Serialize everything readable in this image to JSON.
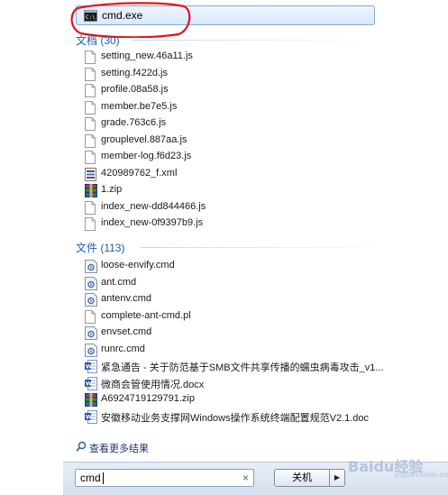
{
  "top_result": {
    "label": "cmd.exe",
    "icon": "cmd-console-icon"
  },
  "documents": {
    "header": "文档 (30)",
    "items": [
      {
        "label": "setting_new.46a11.js",
        "icon": "file"
      },
      {
        "label": "setting.f422d.js",
        "icon": "file"
      },
      {
        "label": "profile.08a58.js",
        "icon": "file"
      },
      {
        "label": "member.be7e5.js",
        "icon": "file"
      },
      {
        "label": "grade.763c6.js",
        "icon": "file"
      },
      {
        "label": "grouplevel.887aa.js",
        "icon": "file"
      },
      {
        "label": "member-log.f6d23.js",
        "icon": "file"
      },
      {
        "label": "420989762_f.xml",
        "icon": "xml"
      },
      {
        "label": "1.zip",
        "icon": "zip"
      },
      {
        "label": "index_new-dd844466.js",
        "icon": "file"
      },
      {
        "label": "index_new-0f9397b9.js",
        "icon": "file"
      }
    ]
  },
  "files": {
    "header": "文件 (113)",
    "items": [
      {
        "label": "loose-envify.cmd",
        "icon": "cmd"
      },
      {
        "label": "ant.cmd",
        "icon": "cmd"
      },
      {
        "label": "antenv.cmd",
        "icon": "cmd"
      },
      {
        "label": "complete-ant-cmd.pl",
        "icon": "file"
      },
      {
        "label": "envset.cmd",
        "icon": "cmd"
      },
      {
        "label": "runrc.cmd",
        "icon": "cmd"
      },
      {
        "label": "紧急通告 - 关于防范基于SMB文件共享传播的蠕虫病毒攻击_v1...",
        "icon": "word"
      },
      {
        "label": "微商会管使用情况.docx",
        "icon": "word"
      },
      {
        "label": "A6924719129791.zip",
        "icon": "zip"
      },
      {
        "label": "安徽移动业务支撑网Windows操作系统终端配置规范V2.1.doc",
        "icon": "word"
      }
    ]
  },
  "more_results": {
    "label": "查看更多结果",
    "icon": "search-icon"
  },
  "search": {
    "value": "cmd",
    "clear_symbol": "×"
  },
  "shutdown": {
    "label": "关机",
    "arrow": "▶"
  },
  "watermark": {
    "brand": "Baidu经验",
    "sub": "jingyan.baidu.com"
  },
  "colors": {
    "header": "#1e5eb0",
    "highlight_border": "#84acdd",
    "annotation_circle": "#e0141e"
  }
}
